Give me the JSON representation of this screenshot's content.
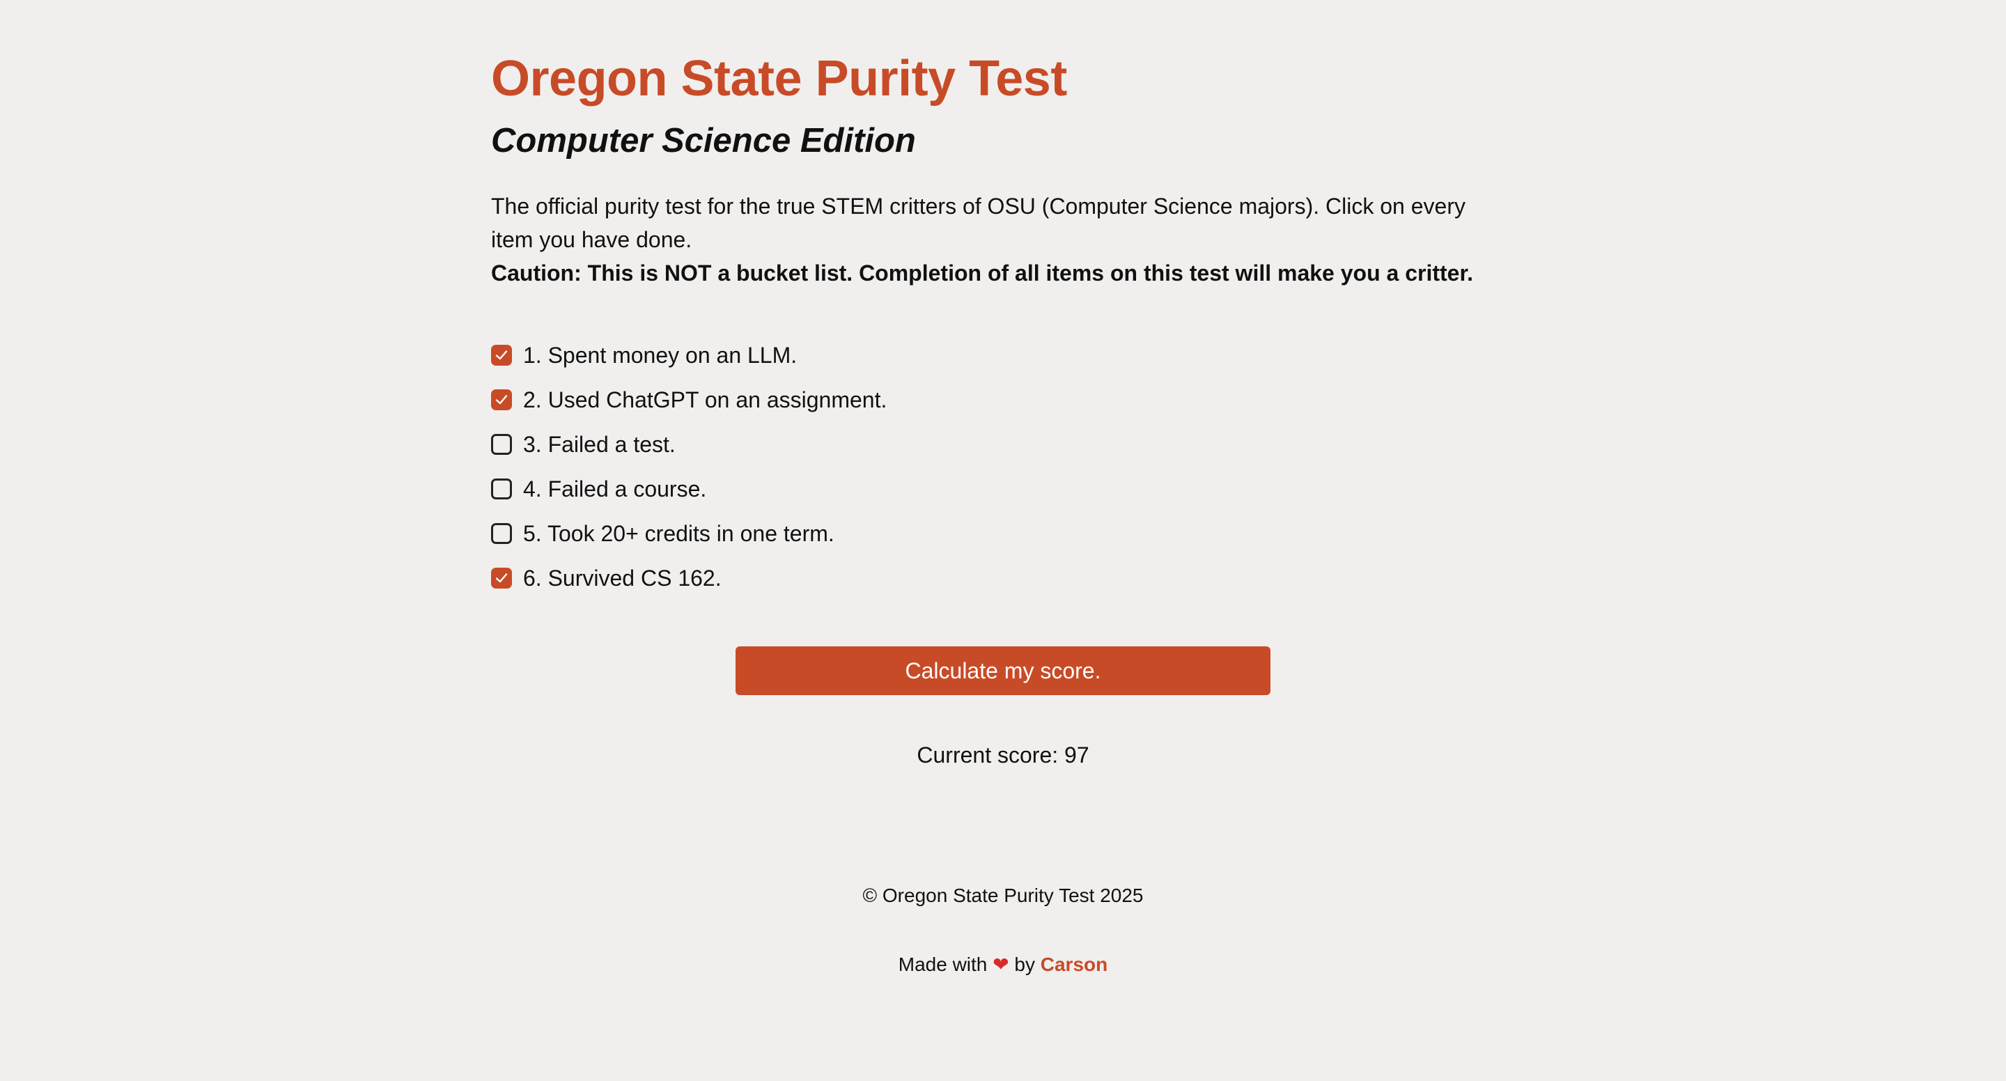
{
  "header": {
    "title": "Oregon State Purity Test",
    "subtitle": "Computer Science Edition"
  },
  "intro": {
    "description": "The official purity test for the true STEM critters of OSU (Computer Science majors). Click on every item you have done.",
    "caution": "Caution: This is NOT a bucket list. Completion of all items on this test will make you a critter."
  },
  "checklist": {
    "items": [
      {
        "label": "1. Spent money on an LLM.",
        "checked": true
      },
      {
        "label": "2. Used ChatGPT on an assignment.",
        "checked": true
      },
      {
        "label": "3. Failed a test.",
        "checked": false
      },
      {
        "label": "4. Failed a course.",
        "checked": false
      },
      {
        "label": "5. Took 20+ credits in one term.",
        "checked": false
      },
      {
        "label": "6. Survived CS 162.",
        "checked": true
      }
    ]
  },
  "actions": {
    "calculate_label": "Calculate my score."
  },
  "score": {
    "text": "Current score: 97"
  },
  "footer": {
    "copyright": "© Oregon State Purity Test 2025",
    "made_prefix": "Made with",
    "heart": "❤",
    "made_by": "by",
    "author": "Carson"
  },
  "colors": {
    "accent": "#c84b27",
    "background": "#f1efee",
    "text": "#111111"
  },
  "icons": {
    "check": "checkmark-icon",
    "heart": "heart-icon"
  }
}
